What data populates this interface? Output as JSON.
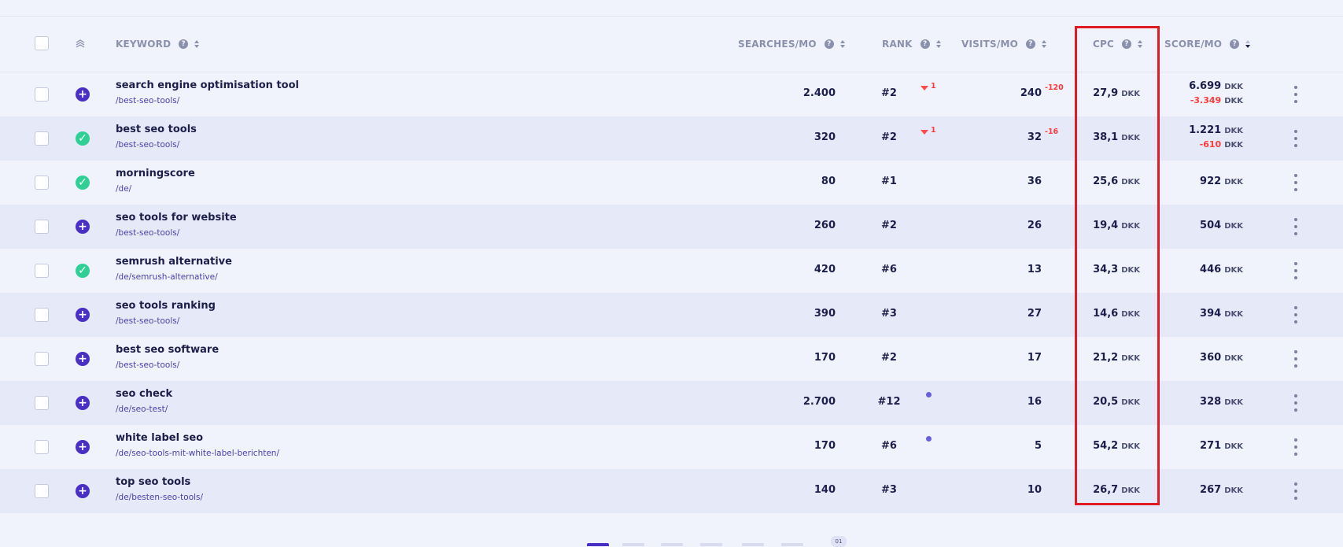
{
  "header": {
    "keyword": "KEYWORD",
    "searches": "SEARCHES/MO",
    "rank": "RANK",
    "visits": "VISITS/MO",
    "cpc": "CPC",
    "score": "SCORE/MO",
    "help_glyph": "?"
  },
  "currency": "DKK",
  "rows": [
    {
      "keyword": "search engine optimisation tool",
      "url": "/best-seo-tools/",
      "status": "add",
      "searches": "2.400",
      "rank": "#2",
      "rank_change": "1",
      "visits": "240",
      "visits_change": "-120",
      "cpc": "27,9",
      "score": "6.699",
      "score_change": "-3.349"
    },
    {
      "keyword": "best seo tools",
      "url": "/best-seo-tools/",
      "status": "ok",
      "searches": "320",
      "rank": "#2",
      "rank_change": "1",
      "visits": "32",
      "visits_change": "-16",
      "cpc": "38,1",
      "score": "1.221",
      "score_change": "-610"
    },
    {
      "keyword": "morningscore",
      "url": "/de/",
      "status": "ok",
      "searches": "80",
      "rank": "#1",
      "visits": "36",
      "cpc": "25,6",
      "score": "922"
    },
    {
      "keyword": "seo tools for website",
      "url": "/best-seo-tools/",
      "status": "add",
      "searches": "260",
      "rank": "#2",
      "visits": "26",
      "cpc": "19,4",
      "score": "504"
    },
    {
      "keyword": "semrush alternative",
      "url": "/de/semrush-alternative/",
      "status": "ok",
      "searches": "420",
      "rank": "#6",
      "visits": "13",
      "cpc": "34,3",
      "score": "446"
    },
    {
      "keyword": "seo tools ranking",
      "url": "/best-seo-tools/",
      "status": "add",
      "searches": "390",
      "rank": "#3",
      "visits": "27",
      "cpc": "14,6",
      "score": "394"
    },
    {
      "keyword": "best seo software",
      "url": "/best-seo-tools/",
      "status": "add",
      "searches": "170",
      "rank": "#2",
      "visits": "17",
      "cpc": "21,2",
      "score": "360"
    },
    {
      "keyword": "seo check",
      "url": "/de/seo-test/",
      "status": "add",
      "searches": "2.700",
      "rank": "#12",
      "rank_dot": true,
      "visits": "16",
      "cpc": "20,5",
      "score": "328"
    },
    {
      "keyword": "white label seo",
      "url": "/de/seo-tools-mit-white-label-berichten/",
      "status": "add",
      "searches": "170",
      "rank": "#6",
      "rank_dot": true,
      "visits": "5",
      "cpc": "54,2",
      "score": "271"
    },
    {
      "keyword": "top seo tools",
      "url": "/de/besten-seo-tools/",
      "status": "add",
      "searches": "140",
      "rank": "#3",
      "visits": "10",
      "cpc": "26,7",
      "score": "267"
    }
  ],
  "pagination": {
    "badge": "01"
  },
  "colors": {
    "highlight": "#e01b24",
    "add": "#4a2fc4",
    "ok": "#2fcf95",
    "negative": "#ff3b3b"
  }
}
